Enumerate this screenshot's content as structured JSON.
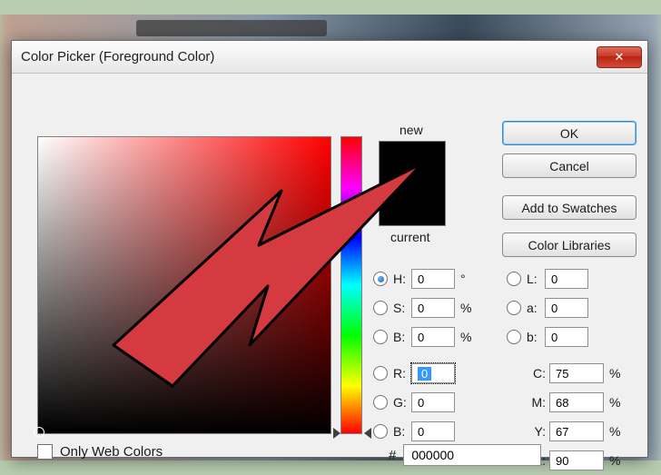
{
  "dialog": {
    "title": "Color Picker (Foreground Color)",
    "close_icon": "✕"
  },
  "buttons": {
    "ok": "OK",
    "cancel": "Cancel",
    "add_swatches": "Add to Swatches",
    "color_libraries": "Color Libraries"
  },
  "swatch": {
    "new_label": "new",
    "current_label": "current",
    "new_color": "#000000",
    "current_color": "#000000"
  },
  "fields": {
    "H": {
      "label": "H:",
      "value": "0",
      "unit": "°",
      "selected": true
    },
    "S": {
      "label": "S:",
      "value": "0",
      "unit": "%"
    },
    "Bv": {
      "label": "B:",
      "value": "0",
      "unit": "%"
    },
    "R": {
      "label": "R:",
      "value": "0",
      "focused": true
    },
    "G": {
      "label": "G:",
      "value": "0"
    },
    "Bc": {
      "label": "B:",
      "value": "0"
    },
    "L": {
      "label": "L:",
      "value": "0"
    },
    "a": {
      "label": "a:",
      "value": "0"
    },
    "b": {
      "label": "b:",
      "value": "0"
    },
    "C": {
      "label": "C:",
      "value": "75",
      "unit": "%"
    },
    "M": {
      "label": "M:",
      "value": "68",
      "unit": "%"
    },
    "Y": {
      "label": "Y:",
      "value": "67",
      "unit": "%"
    },
    "K": {
      "label": "K:",
      "value": "90",
      "unit": "%"
    }
  },
  "hex": {
    "hash": "#",
    "value": "000000"
  },
  "only_web": {
    "label": "Only Web Colors",
    "checked": false
  },
  "overlay": {
    "arrow_color": "#d43a3f"
  }
}
